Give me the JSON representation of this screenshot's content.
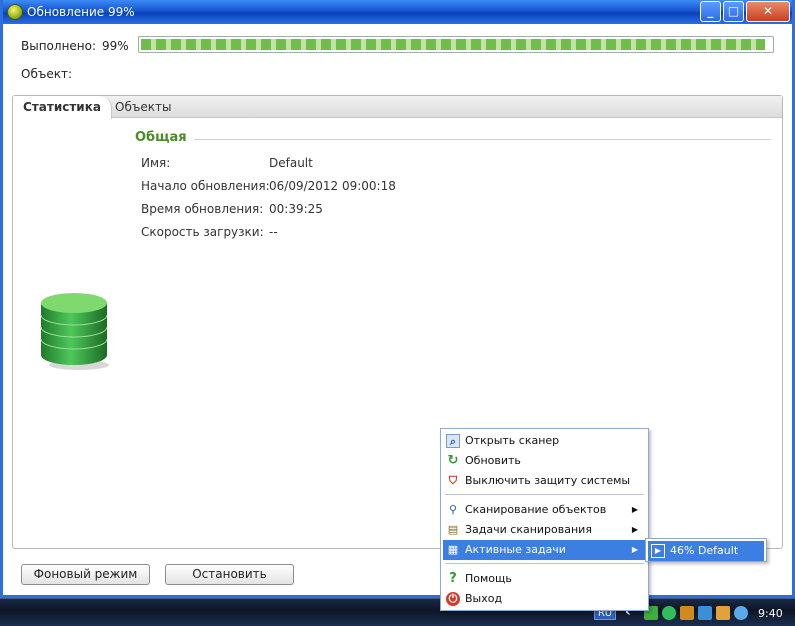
{
  "window": {
    "title": "Обновление 99%",
    "icon": "update-app-icon",
    "controls": {
      "minimize": "_",
      "maximize": "□",
      "close": "✕"
    }
  },
  "progress": {
    "done_label": "Выполнено:",
    "percent_text": "99%",
    "value_percent": 99,
    "object_label": "Объект:"
  },
  "tabs": [
    {
      "label": "Статистика",
      "active": true
    },
    {
      "label": "Объекты",
      "active": false
    }
  ],
  "stats": {
    "section_title": "Общая",
    "rows": [
      {
        "label": "Имя:",
        "value": "Default"
      },
      {
        "label": "Начало обновления:",
        "value": "06/09/2012 09:00:18"
      },
      {
        "label": "Время обновления:",
        "value": "00:39:25"
      },
      {
        "label": "Скорость загрузки:",
        "value": "--"
      }
    ]
  },
  "buttons": {
    "background_mode": "Фоновый режим",
    "stop": "Остановить"
  },
  "context_menu": {
    "items": [
      {
        "label": "Открыть сканер",
        "icon": "scanner-icon"
      },
      {
        "label": "Обновить",
        "icon": "refresh-icon"
      },
      {
        "label": "Выключить защиту системы",
        "icon": "shield-off-icon"
      },
      {
        "label": "Сканирование объектов",
        "icon": "magnifier-icon",
        "submenu": true
      },
      {
        "label": "Задачи сканирования",
        "icon": "tasks-icon",
        "submenu": true
      },
      {
        "label": "Активные задачи",
        "icon": "active-tasks-icon",
        "submenu": true,
        "highlighted": true
      },
      {
        "label": "Помощь",
        "icon": "help-icon"
      },
      {
        "label": "Выход",
        "icon": "power-icon"
      }
    ],
    "submenu_item": "46% Default"
  },
  "taskbar": {
    "language": "RU",
    "clock": "9:40"
  },
  "colors": {
    "accent_green": "#4a8c24",
    "menu_highlight": "#3d7ee3",
    "title_blue": "#1654cf"
  }
}
